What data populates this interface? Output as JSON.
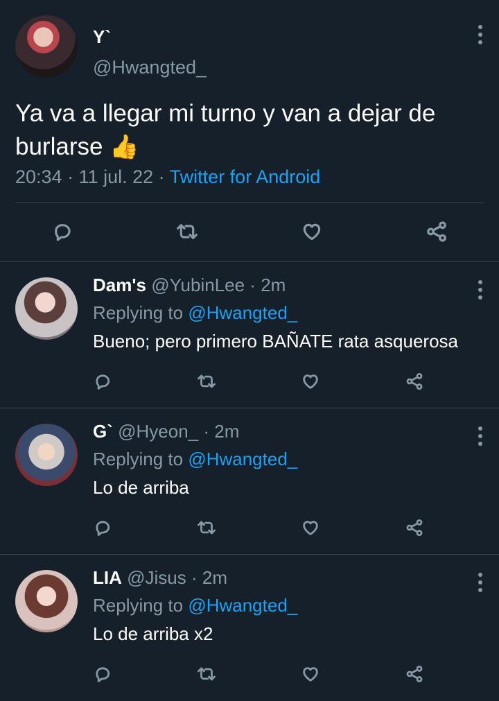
{
  "main_tweet": {
    "author_name": "Y`",
    "author_handle": "@Hwangted_",
    "text": "Ya va a llegar mi turno y van a dejar de burlarse",
    "emoji": "👍",
    "time": "20:34",
    "date": "11 jul. 22",
    "source": "Twitter for Android",
    "separator": " · "
  },
  "replies": [
    {
      "name": "Dam's",
      "handle": "@YubinLee",
      "time": "2m",
      "replying_prefix": "Replying to ",
      "replying_to": "@Hwangted_",
      "text": "Bueno; pero primero BAÑATE rata asquerosa"
    },
    {
      "name": "G`",
      "handle": "@Hyeon_",
      "time": "2m",
      "replying_prefix": "Replying to ",
      "replying_to": "@Hwangted_",
      "text": "Lo de arriba"
    },
    {
      "name": "LIA",
      "handle": "@Jisus",
      "time": "2m",
      "replying_prefix": "Replying to ",
      "replying_to": "@Hwangted_",
      "text": "Lo de arriba x2"
    }
  ],
  "colors": {
    "background": "#15202b",
    "muted": "#8899a6",
    "link": "#1da1f2",
    "divider": "#38444d"
  },
  "icons": [
    "reply-icon",
    "retweet-icon",
    "like-icon",
    "share-icon",
    "more-options-icon"
  ]
}
